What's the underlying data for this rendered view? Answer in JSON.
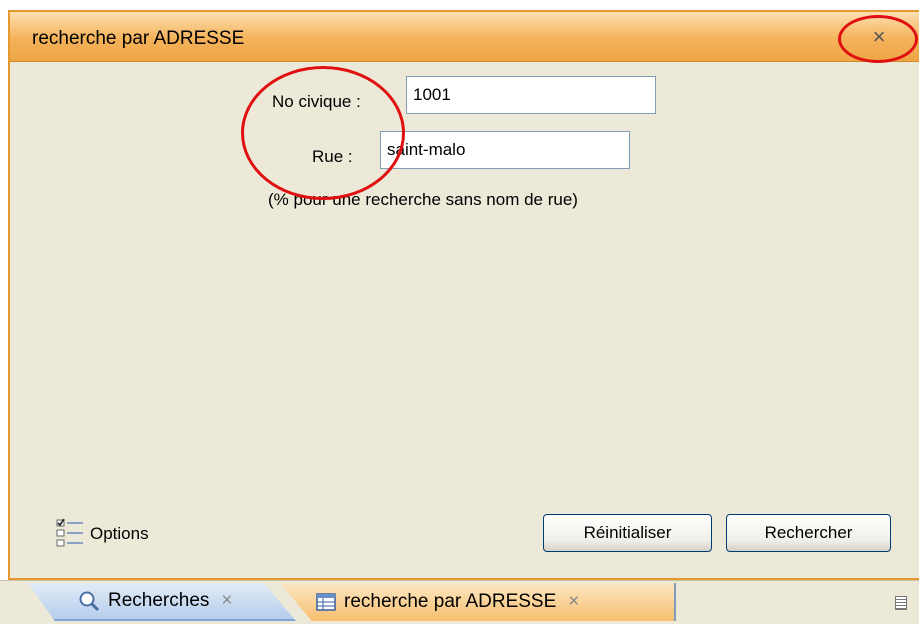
{
  "window": {
    "title": "recherche par ADRESSE",
    "close_label": "×"
  },
  "form": {
    "civic_label": "No civique :",
    "civic_value": "1001",
    "street_label": "Rue :",
    "street_value": "saint-malo",
    "hint": "(% pour une recherche sans nom de rue)"
  },
  "footer": {
    "options_label": "Options",
    "reset_label": "Réinitialiser",
    "search_label": "Rechercher"
  },
  "tabs": [
    {
      "label": "Recherches",
      "icon": "magnifier-icon",
      "close": "×"
    },
    {
      "label": "recherche par ADRESSE",
      "icon": "table-icon",
      "close": "×"
    }
  ],
  "colors": {
    "accent": "#f4b25a",
    "annotation": "#e01010",
    "panel": "#ece9d8"
  }
}
